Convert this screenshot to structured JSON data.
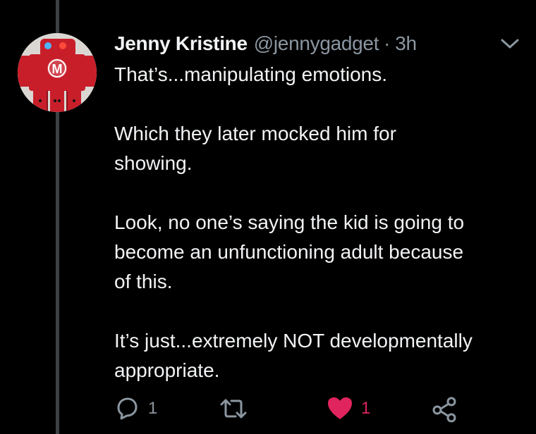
{
  "tweet": {
    "author_name": "Jenny Kristine",
    "handle": "@jennygadget",
    "separator": "·",
    "time": "3h",
    "paragraphs": [
      "That’s...manipulating emotions.",
      "Which they later mocked him for\nshowing.",
      "Look, no one’s saying the kid is going to\nbecome an unfunctioning adult because\nof this.",
      "It’s just...extremely NOT developmentally\nappropriate."
    ]
  },
  "avatar": {
    "letter": "M"
  },
  "actions": {
    "reply_icon": "reply-icon",
    "reply_count": "1",
    "retweet_icon": "retweet-icon",
    "like_icon": "heart-icon",
    "like_count": "1",
    "share_icon": "share-icon"
  },
  "colors": {
    "background": "#000000",
    "text": "#f2f3f5",
    "secondary": "#8b96a0",
    "like": "#e0245e",
    "thread_line": "#3d4146"
  }
}
